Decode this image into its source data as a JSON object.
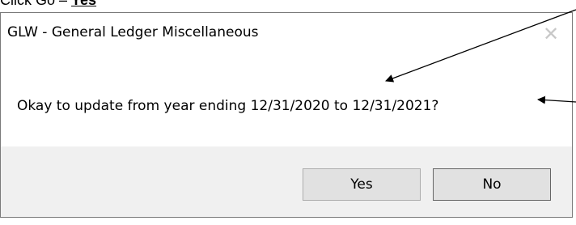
{
  "document_fragment": {
    "text": "Click Go – ",
    "underlined": "Yes"
  },
  "dialog": {
    "title": "GLW - General Ledger Miscellaneous",
    "close_symbol": "✕",
    "message": "Okay to update from year ending 12/31/2020 to 12/31/2021?",
    "buttons": {
      "yes_label": "Yes",
      "no_label": "No"
    }
  },
  "icons": [
    "close-icon"
  ]
}
